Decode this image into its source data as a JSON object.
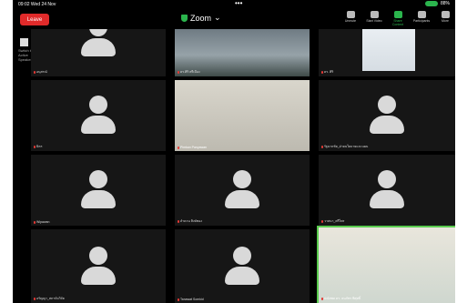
{
  "status_bar": {
    "time": "09:02  Wed 24 Nov",
    "dots": "•••",
    "battery": "88%"
  },
  "header": {
    "leave_label": "Leave",
    "title": "Zoom",
    "tools": [
      "Unmute",
      "Start Video",
      "Share Content",
      "Participants",
      "More"
    ]
  },
  "sidebar": {
    "label": "Switch to Active Speaker"
  },
  "tiles": [
    {
      "name": "อนุสรณ์",
      "kind": "avatar"
    },
    {
      "name": "ดร.ศิริ ศรีเมือง",
      "kind": "room"
    },
    {
      "name": "ดร. ศิริ",
      "kind": "man"
    },
    {
      "name": "มิตร",
      "kind": "avatar"
    },
    {
      "name": "Pimkan Panyawan",
      "kind": "woman"
    },
    {
      "name": "รัฐนาถชัย_ฝ่ายนโยบายและแผน",
      "kind": "avatar"
    },
    {
      "name": "Wipawan",
      "kind": "avatar"
    },
    {
      "name": "ลำดวน สิงห์ทอง",
      "kind": "avatar"
    },
    {
      "name": "วาสนา_ศรีไพร",
      "kind": "avatar"
    },
    {
      "name": "อรัญญา_สถาบันวิจัย",
      "kind": "avatar"
    },
    {
      "name": "Tanawat Somkid",
      "kind": "avatar"
    },
    {
      "name": "ปณัสพล ดร. ธนภัทร พิสุทธิ์",
      "kind": "talker"
    }
  ]
}
